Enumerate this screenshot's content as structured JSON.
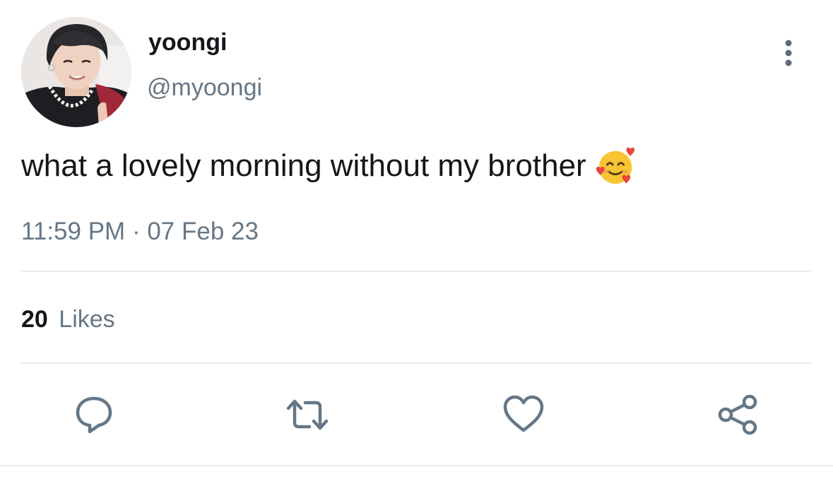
{
  "author": {
    "display_name": "yoongi",
    "handle": "@myoongi",
    "avatar": "profile-photo"
  },
  "tweet": {
    "text": "what a lovely morning without my brother",
    "emoji": "smiling-face-with-hearts"
  },
  "meta": {
    "time": "11:59 PM",
    "separator": "·",
    "date": "07 Feb 23"
  },
  "stats": {
    "likes_count": "20",
    "likes_label": "Likes"
  },
  "actions": [
    {
      "name": "reply",
      "icon": "reply-icon"
    },
    {
      "name": "retweet",
      "icon": "retweet-icon"
    },
    {
      "name": "like",
      "icon": "heart-icon"
    },
    {
      "name": "share",
      "icon": "share-icon"
    }
  ],
  "colors": {
    "primary_text": "#14171a",
    "secondary_text": "#657786",
    "divider": "#e6ecf0",
    "icon": "#657786"
  }
}
